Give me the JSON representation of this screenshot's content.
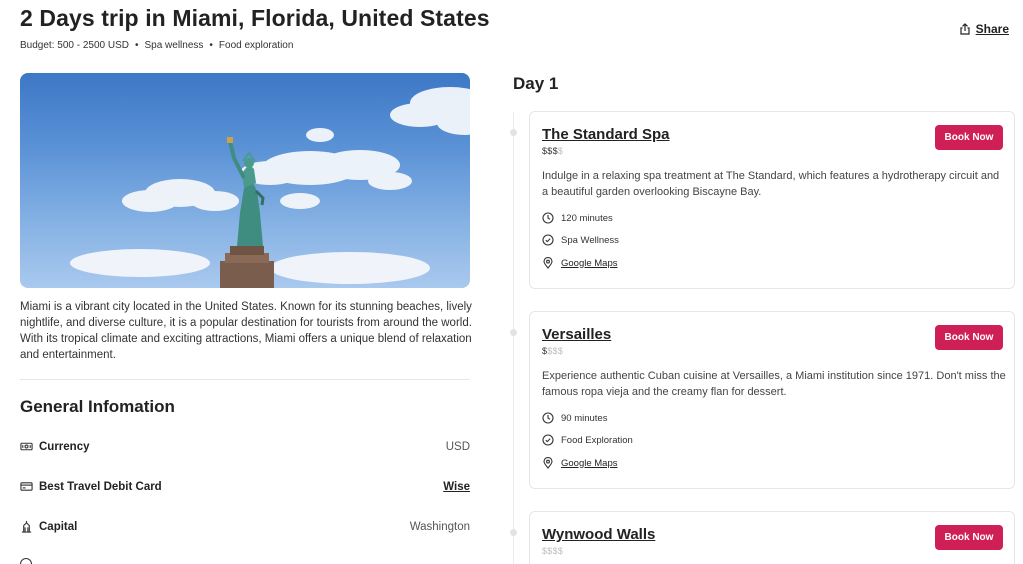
{
  "header": {
    "title": "2 Days trip in Miami, Florida, United States",
    "budget": "Budget: 500 - 2500 USD",
    "tag1": "Spa wellness",
    "tag2": "Food exploration",
    "bullet": "•",
    "share_label": "Share"
  },
  "overview": {
    "description": "Miami is a vibrant city located in the United States. Known for its stunning beaches, lively nightlife, and diverse culture, it is a popular destination for tourists from around the world. With its tropical climate and exciting attractions, Miami offers a unique blend of relaxation and entertainment."
  },
  "general_info": {
    "title": "General Infomation",
    "rows": [
      {
        "label": "Currency",
        "value": "USD",
        "icon": "banknote-icon"
      },
      {
        "label": "Best Travel Debit Card",
        "value": "Wise",
        "icon": "credit-card-icon"
      },
      {
        "label": "Capital",
        "value": "Washington",
        "icon": "landmark-icon"
      }
    ]
  },
  "itinerary": {
    "day_title": "Day 1",
    "book_label": "Book Now",
    "maps_label": "Google Maps",
    "activities": [
      {
        "name": "The Standard Spa",
        "price_on": "$$$",
        "price_off": "$",
        "description": "Indulge in a relaxing spa treatment at The Standard, which features a hydrotherapy circuit and a beautiful garden overlooking Biscayne Bay.",
        "duration": "120 minutes",
        "category": "Spa Wellness"
      },
      {
        "name": "Versailles",
        "price_on": "$",
        "price_off": "$$$",
        "description": "Experience authentic Cuban cuisine at Versailles, a Miami institution since 1971. Don't miss the famous ropa vieja and the creamy flan for dessert.",
        "duration": "90 minutes",
        "category": "Food Exploration"
      },
      {
        "name": "Wynwood Walls",
        "price_on": "",
        "price_off": "$$$$"
      }
    ]
  },
  "colors": {
    "accent": "#cf1f57",
    "text": "#222222",
    "muted": "#555555"
  }
}
